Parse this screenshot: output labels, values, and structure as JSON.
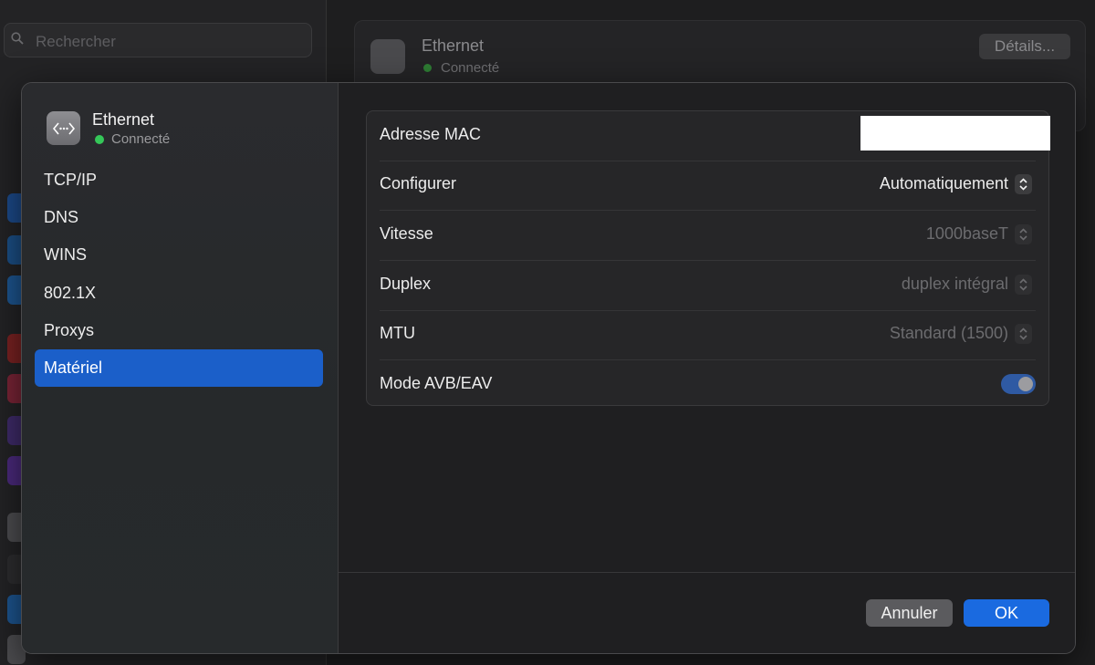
{
  "background": {
    "search_placeholder": "Rechercher",
    "service_title": "Ethernet",
    "service_status": "Connecté",
    "details_button": "Détails..."
  },
  "sheet": {
    "header": {
      "title": "Ethernet",
      "status": "Connecté",
      "status_color": "#35c759"
    },
    "nav_items": [
      {
        "label": "TCP/IP"
      },
      {
        "label": "DNS"
      },
      {
        "label": "WINS"
      },
      {
        "label": "802.1X"
      },
      {
        "label": "Proxys"
      },
      {
        "label": "Matériel",
        "selected": true
      }
    ],
    "settings": {
      "mac": {
        "label": "Adresse MAC",
        "value": ""
      },
      "configure": {
        "label": "Configurer",
        "value": "Automatiquement"
      },
      "speed": {
        "label": "Vitesse",
        "value": "1000baseT"
      },
      "duplex": {
        "label": "Duplex",
        "value": "duplex intégral"
      },
      "mtu": {
        "label": "MTU",
        "value": "Standard (1500)"
      },
      "avb": {
        "label": "Mode AVB/EAV",
        "enabled": true
      }
    },
    "buttons": {
      "cancel": "Annuler",
      "ok": "OK"
    }
  },
  "colors": {
    "accent": "#1a6ae0",
    "selection": "#1b5fc9"
  }
}
